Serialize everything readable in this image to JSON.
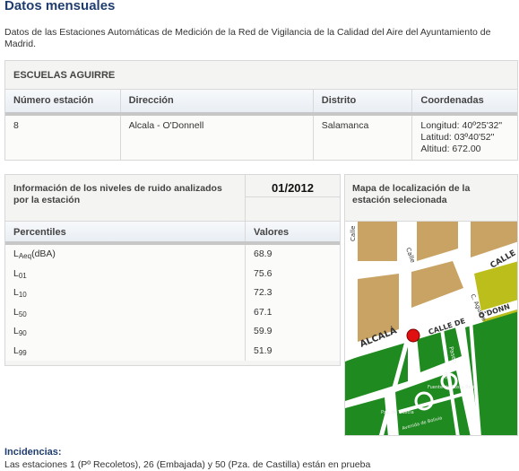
{
  "page": {
    "title": "Datos mensuales",
    "intro": "Datos de las Estaciones Automáticas de Medición de la Red de Vigilancia de la Calidad del Aire del Ayuntamiento de Madrid."
  },
  "station": {
    "name": "ESCUELAS AGUIRRE",
    "headers": {
      "number": "Número estación",
      "address": "Dirección",
      "district": "Distrito",
      "coords": "Coordenadas"
    },
    "number": "8",
    "address": "Alcala - O'Donnell",
    "district": "Salamanca",
    "longitude": "Longitud: 40º25'32\"",
    "latitude": "Latitud: 03º40'52\"",
    "altitude": "Altitud: 672.00"
  },
  "noise": {
    "info_title": "Información de los niveles de ruido analizados por la estación",
    "date": "01/2012",
    "col_percentiles": "Percentiles",
    "col_values": "Valores",
    "rows": [
      {
        "base": "L",
        "sub": "Aeq",
        "suffix": "(dBA)",
        "value": "68.9"
      },
      {
        "base": "L",
        "sub": "01",
        "suffix": "",
        "value": "75.6"
      },
      {
        "base": "L",
        "sub": "10",
        "suffix": "",
        "value": "72.3"
      },
      {
        "base": "L",
        "sub": "50",
        "suffix": "",
        "value": "67.1"
      },
      {
        "base": "L",
        "sub": "90",
        "suffix": "",
        "value": "59.9"
      },
      {
        "base": "L",
        "sub": "99",
        "suffix": "",
        "value": "51.9"
      }
    ]
  },
  "map": {
    "title": "Mapa de localización de la estación selecionada",
    "labels": {
      "alcala": "ALCALÁ",
      "calle_de": "CALLE DE",
      "odonnell": "O'DONN",
      "calle_top": "CALLE",
      "calle_left": "Calle",
      "calle_mid": "Calle",
      "aguirre": "C. Aguirre",
      "paseo": "Paseo",
      "costa_rica": "Fuente de Costa Rica",
      "pza_galicia": "Pza. de Galicia",
      "bolivia": "Avenida de Bolivia",
      "de": "de"
    },
    "colors": {
      "block": "#c9a363",
      "park": "#1f8a1f",
      "lime": "#bcbf1b",
      "road": "#ffffff",
      "marker": "#e01010"
    }
  },
  "incidents": {
    "title": "Incidencias:",
    "text": "Las estaciones 1 (Pº Recoletos), 26 (Embajada) y 50 (Pza. de Castilla) están en prueba"
  }
}
